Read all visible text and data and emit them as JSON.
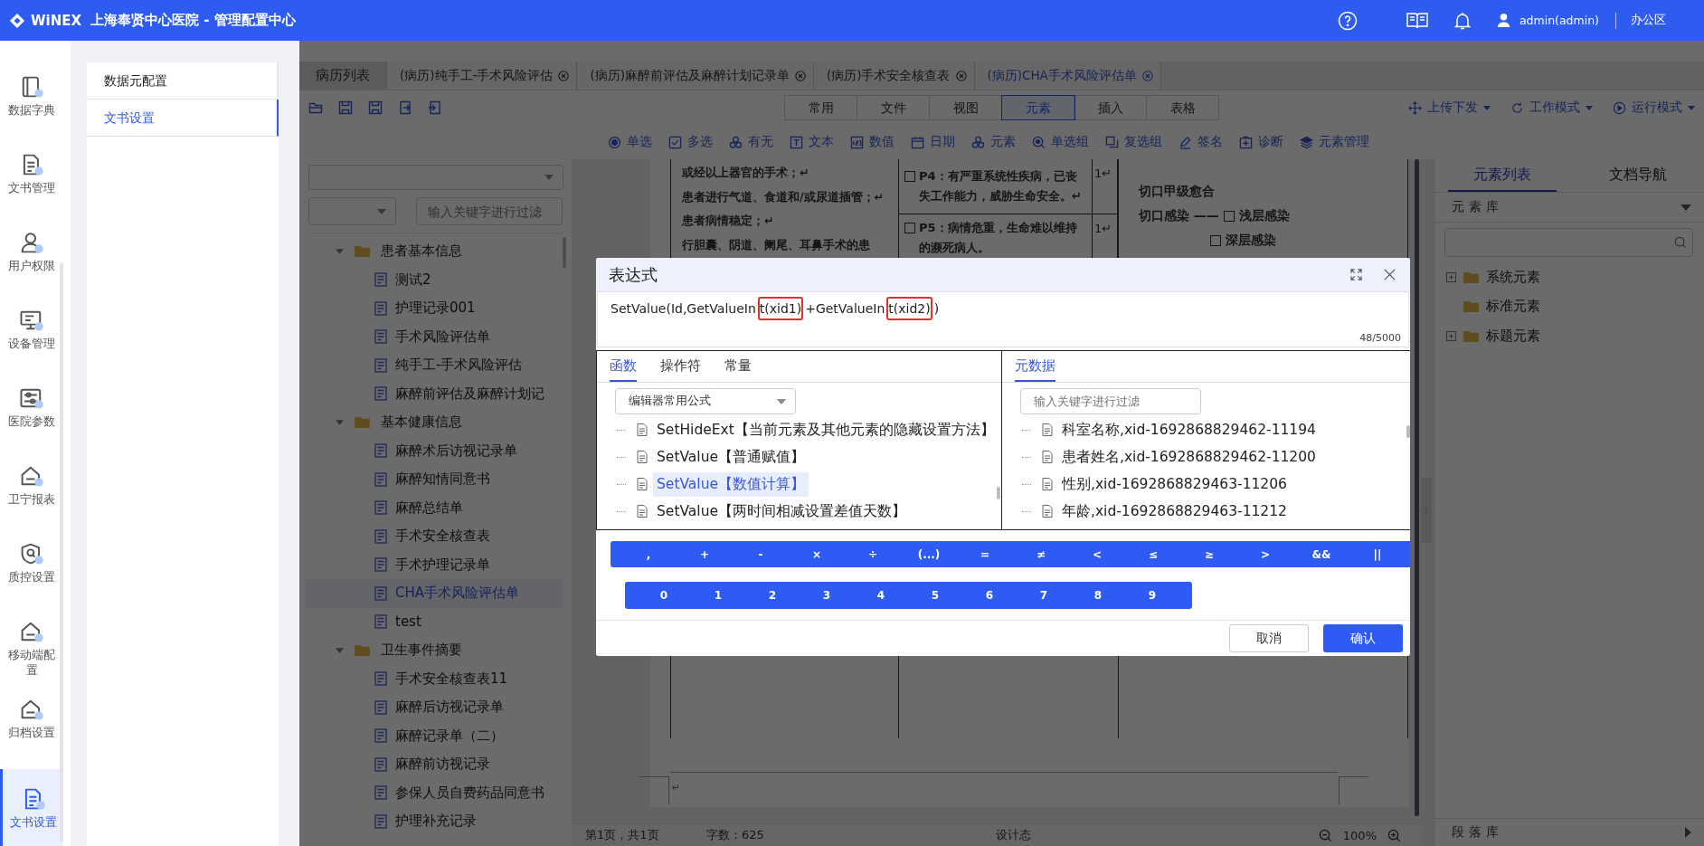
{
  "header": {
    "logo": "WiNEX",
    "title": "上海奉贤中心医院 - 管理配置中心",
    "user": "admin(admin)",
    "area": "办公区"
  },
  "nav": [
    {
      "label": "数据字典",
      "selected": false
    },
    {
      "label": "文书管理",
      "selected": false
    },
    {
      "label": "用户权限",
      "selected": false
    },
    {
      "label": "设备管理",
      "selected": false
    },
    {
      "label": "医院参数",
      "selected": false
    },
    {
      "label": "卫宁报表",
      "selected": false
    },
    {
      "label": "质控设置",
      "selected": false
    },
    {
      "label": "移动端配置",
      "selected": false
    },
    {
      "label": "归档设置",
      "selected": false
    },
    {
      "label": "文书设置",
      "selected": true
    }
  ],
  "config_menu": [
    {
      "label": "数据元配置",
      "selected": false
    },
    {
      "label": "文书设置",
      "selected": true
    }
  ],
  "doc_tabs": [
    {
      "label": "病历列表",
      "kind": "home",
      "selected": false
    },
    {
      "label": "(病历)纯手工-手术风险评估",
      "kind": "doc",
      "selected": false
    },
    {
      "label": "(病历)麻醉前评估及麻醉计划记录单",
      "kind": "doc",
      "selected": false
    },
    {
      "label": "(病历)手术安全核查表",
      "kind": "doc",
      "selected": false
    },
    {
      "label": "(病历)CHA手术风险评估单",
      "kind": "doc",
      "selected": true
    }
  ],
  "ribbon_tabs": [
    {
      "label": "常用",
      "selected": false
    },
    {
      "label": "文件",
      "selected": false
    },
    {
      "label": "视图",
      "selected": false
    },
    {
      "label": "元素",
      "selected": true
    },
    {
      "label": "插入",
      "selected": false
    },
    {
      "label": "表格",
      "selected": false
    }
  ],
  "mode_menus": [
    "上传下发",
    "工作模式",
    "运行模式"
  ],
  "element_tools": [
    "单选",
    "多选",
    "有无",
    "文本",
    "数值",
    "日期",
    "元素",
    "单选组",
    "复选组",
    "签名",
    "诊断",
    "元素管理"
  ],
  "tree_filter": {
    "placeholder": "输入关键字进行过滤"
  },
  "tree": [
    {
      "label": "患者基本信息",
      "expanded": true,
      "children": [
        {
          "label": "测试2",
          "selected": false
        },
        {
          "label": "护理记录001",
          "selected": false
        },
        {
          "label": "手术风险评估单",
          "selected": false
        },
        {
          "label": "纯手工-手术风险评估",
          "selected": false
        },
        {
          "label": "麻醉前评估及麻醉计划记",
          "selected": false
        }
      ]
    },
    {
      "label": "基本健康信息",
      "expanded": true,
      "children": [
        {
          "label": "麻醉术后访视记录单",
          "selected": false
        },
        {
          "label": "麻醉知情同意书",
          "selected": false
        },
        {
          "label": "麻醉总结单",
          "selected": false
        },
        {
          "label": "手术安全核查表",
          "selected": false
        },
        {
          "label": "手术护理记录单",
          "selected": false
        },
        {
          "label": "CHA手术风险评估单",
          "selected": true
        },
        {
          "label": "test",
          "selected": false
        }
      ]
    },
    {
      "label": "卫生事件摘要",
      "expanded": true,
      "children": [
        {
          "label": "手术安全核查表11",
          "selected": false
        },
        {
          "label": "麻醉后访视记录单",
          "selected": false
        },
        {
          "label": "麻醉记录单（二）",
          "selected": false
        },
        {
          "label": "麻醉前访视记录",
          "selected": false
        },
        {
          "label": "参保人员自费药品同意书",
          "selected": false
        },
        {
          "label": "护理补充记录",
          "selected": false
        }
      ]
    }
  ],
  "document": {
    "lines": [
      "或经以上器官的手术；↵",
      "患者进行气道、食道和/或尿道插管；↵",
      "患者病情稳定；↵",
      "行胆囊、阴道、阑尾、耳鼻手术的患"
    ],
    "options": [
      {
        "checked": false,
        "text": "P4：有严重系统性疾病，已丧失工作能力，威胁生命安全。↵",
        "score": "1↵"
      },
      {
        "checked": false,
        "text": "P5：病情危重，生命难以维持的濒死病人。",
        "score": "1↵"
      }
    ],
    "outcome": [
      {
        "kind": "text",
        "text": "切口甲级愈合"
      },
      {
        "kind": "choice",
        "prefix": "切口感染 ——",
        "checked": false,
        "text": "浅层感染"
      },
      {
        "kind": "choice",
        "checked": false,
        "text": "深层感染"
      }
    ],
    "footer_mark": "↵"
  },
  "status_bar": {
    "pages": "第1页，共1页",
    "word_count": "字数：625",
    "mode": "设计态",
    "zoom": "100%"
  },
  "right_panel": {
    "tabs": [
      {
        "label": "元素列表",
        "selected": true
      },
      {
        "label": "文档导航",
        "selected": false
      }
    ],
    "library": "元素库",
    "tree": [
      {
        "label": "系统元素",
        "expandable": true
      },
      {
        "label": "标准元素",
        "expandable": false
      },
      {
        "label": "标题元素",
        "expandable": true
      }
    ],
    "bottom": "段落库"
  },
  "dialog": {
    "title": "表达式",
    "expression_parts": [
      {
        "text": "SetValue(Id,GetValueIn",
        "marked": false
      },
      {
        "text": "t(xid1)",
        "marked": true
      },
      {
        "text": "+GetValueIn",
        "marked": false
      },
      {
        "text": "t(xid2)",
        "marked": true
      },
      {
        "text": ")",
        "marked": false
      }
    ],
    "counter": "48/5000",
    "function_tabs": [
      {
        "label": "函数",
        "selected": true
      },
      {
        "label": "操作符",
        "selected": false
      },
      {
        "label": "常量",
        "selected": false
      }
    ],
    "formula_select": "编辑器常用公式",
    "functions": [
      {
        "label": "SetHideExt【当前元素及其他元素的隐藏设置方法】",
        "selected": false
      },
      {
        "label": "SetValue【普通赋值】",
        "selected": false
      },
      {
        "label": "SetValue【数值计算】",
        "selected": true
      },
      {
        "label": "SetValue【两时间相减设置差值天数】",
        "selected": false
      }
    ],
    "data_tabs": [
      {
        "label": "元数据",
        "selected": true
      }
    ],
    "data_filter": {
      "placeholder": "输入关键字进行过滤"
    },
    "data_items": [
      "科室名称,xid-1692868829462-11194",
      "患者姓名,xid-1692868829462-11200",
      "性别,xid-1692868829463-11206",
      "年龄,xid-1692868829463-11212"
    ],
    "operators": [
      ",",
      "+",
      "-",
      "×",
      "÷",
      "(...)",
      "=",
      "≠",
      "<",
      "≤",
      "≥",
      ">",
      "&&",
      "||"
    ],
    "digits": [
      "0",
      "1",
      "2",
      "3",
      "4",
      "5",
      "6",
      "7",
      "8",
      "9"
    ],
    "buttons": {
      "cancel": "取消",
      "confirm": "确认"
    }
  }
}
